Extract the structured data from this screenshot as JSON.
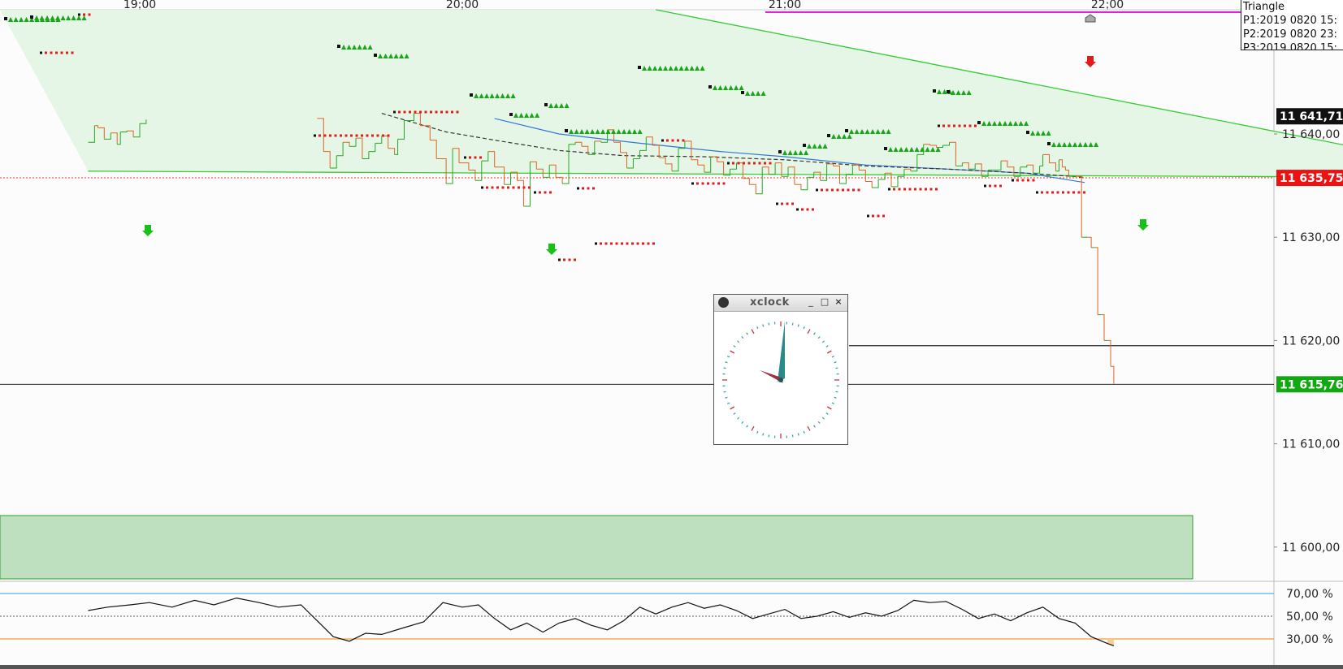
{
  "window": {
    "title": "xclock",
    "minimize_icon": "minimize-icon",
    "maximize_icon": "maximize-icon",
    "close_icon": "close-icon",
    "app_icon": "clock-icon"
  },
  "legend": {
    "title": "Triangle",
    "lines": [
      "P1:2019 0820 15:",
      "P2:2019 0820 23:",
      "P3:2019 0820 15:"
    ]
  },
  "time_axis": [
    {
      "label": "19:00",
      "t": 19.0
    },
    {
      "label": "20:00",
      "t": 20.0
    },
    {
      "label": "21:00",
      "t": 21.0
    },
    {
      "label": "22:00",
      "t": 22.0
    }
  ],
  "price_axis": [
    {
      "label": "11 640,00",
      "v": 11640
    },
    {
      "label": "11 630,00",
      "v": 11630
    },
    {
      "label": "11 620,00",
      "v": 11620
    },
    {
      "label": "11 610,00",
      "v": 11610
    },
    {
      "label": "11 600,00",
      "v": 11600
    }
  ],
  "price_tags": [
    {
      "label": "11 641,71",
      "v": 11641.71,
      "color": "#111111"
    },
    {
      "label": "11 635,75",
      "v": 11635.75,
      "color": "#ee1111"
    },
    {
      "label": "11 615,76",
      "v": 11615.76,
      "color": "#12a812"
    }
  ],
  "rsi_axis": [
    {
      "label": "70,00 %",
      "v": 70
    },
    {
      "label": "50,00 %",
      "v": 50
    },
    {
      "label": "30,00 %",
      "v": 30
    }
  ],
  "colors": {
    "up": "#22aa22",
    "down": "#dd6622",
    "ma_fast": "#3377dd",
    "triangle": "#33cc33",
    "triangle_fill": "#e6f6e6",
    "zone_fill": "#bfe0bf",
    "magenta": "#dd22dd",
    "rsi_top": "#4fb4e6",
    "rsi_bottom": "#f0a030",
    "rsi_fill": "#f6cd98"
  },
  "chart_data": {
    "type": "line",
    "x_unit": "hour",
    "series": [
      {
        "values": [
          [
            18.84,
            11639.2
          ],
          [
            18.86,
            11640.8
          ],
          [
            18.87,
            11640.6
          ],
          [
            18.89,
            11639.5
          ],
          [
            18.91,
            11640.1
          ],
          [
            18.93,
            11639.0
          ],
          [
            18.94,
            11640.2
          ],
          [
            18.96,
            11640.3
          ],
          [
            18.98,
            11639.7
          ],
          [
            19.0,
            11641.0
          ],
          [
            19.02,
            11641.4
          ],
          [
            19.55,
            11641.5
          ],
          [
            19.57,
            11638.3
          ],
          [
            19.59,
            11636.7
          ],
          [
            19.61,
            11637.9
          ],
          [
            19.63,
            11639.2
          ],
          [
            19.65,
            11638.8
          ],
          [
            19.67,
            11639.6
          ],
          [
            19.69,
            11637.6
          ],
          [
            19.71,
            11638.3
          ],
          [
            19.73,
            11639.1
          ],
          [
            19.75,
            11639.8
          ],
          [
            19.77,
            11638.6
          ],
          [
            19.79,
            11638.0
          ],
          [
            19.8,
            11639.5
          ],
          [
            19.82,
            11641.3
          ],
          [
            19.85,
            11642.0
          ],
          [
            19.87,
            11640.8
          ],
          [
            19.9,
            11639.4
          ],
          [
            19.92,
            11637.6
          ],
          [
            19.95,
            11635.2
          ],
          [
            19.97,
            11638.6
          ],
          [
            19.99,
            11637.2
          ],
          [
            20.02,
            11636.5
          ],
          [
            20.04,
            11635.5
          ],
          [
            20.06,
            11637.4
          ],
          [
            20.08,
            11638.3
          ],
          [
            20.1,
            11636.8
          ],
          [
            20.13,
            11635.1
          ],
          [
            20.15,
            11636.3
          ],
          [
            20.17,
            11635.5
          ],
          [
            20.19,
            11633.0
          ],
          [
            20.21,
            11637.3
          ],
          [
            20.23,
            11636.6
          ],
          [
            20.25,
            11635.8
          ],
          [
            20.27,
            11637.0
          ],
          [
            20.29,
            11635.8
          ],
          [
            20.31,
            11635.2
          ],
          [
            20.33,
            11639.0
          ],
          [
            20.35,
            11639.2
          ],
          [
            20.37,
            11638.8
          ],
          [
            20.39,
            11638.0
          ],
          [
            20.41,
            11639.3
          ],
          [
            20.43,
            11639.2
          ],
          [
            20.45,
            11640.4
          ],
          [
            20.47,
            11639.2
          ],
          [
            20.49,
            11638.2
          ],
          [
            20.51,
            11636.7
          ],
          [
            20.53,
            11637.6
          ],
          [
            20.55,
            11638.4
          ],
          [
            20.57,
            11639.7
          ],
          [
            20.59,
            11638.9
          ],
          [
            20.61,
            11637.7
          ],
          [
            20.63,
            11637.1
          ],
          [
            20.65,
            11636.4
          ],
          [
            20.67,
            11638.6
          ],
          [
            20.69,
            11639.3
          ],
          [
            20.71,
            11637.5
          ],
          [
            20.73,
            11637.0
          ],
          [
            20.75,
            11636.3
          ],
          [
            20.77,
            11637.8
          ],
          [
            20.79,
            11637.3
          ],
          [
            20.81,
            11636.0
          ],
          [
            20.83,
            11636.6
          ],
          [
            20.85,
            11637.2
          ],
          [
            20.87,
            11635.7
          ],
          [
            20.89,
            11635.1
          ],
          [
            20.91,
            11634.2
          ],
          [
            20.93,
            11636.8
          ],
          [
            20.95,
            11636.1
          ],
          [
            20.97,
            11637.2
          ],
          [
            20.99,
            11635.9
          ],
          [
            21.01,
            11636.8
          ],
          [
            21.03,
            11635.1
          ],
          [
            21.05,
            11634.6
          ],
          [
            21.07,
            11635.8
          ],
          [
            21.09,
            11636.3
          ],
          [
            21.11,
            11635.5
          ],
          [
            21.13,
            11637.1
          ],
          [
            21.15,
            11636.9
          ],
          [
            21.17,
            11635.2
          ],
          [
            21.19,
            11636.1
          ],
          [
            21.21,
            11637.0
          ],
          [
            21.23,
            11636.5
          ],
          [
            21.25,
            11635.4
          ],
          [
            21.27,
            11634.8
          ],
          [
            21.29,
            11635.6
          ],
          [
            21.31,
            11636.2
          ],
          [
            21.33,
            11634.9
          ],
          [
            21.35,
            11635.9
          ],
          [
            21.37,
            11636.6
          ],
          [
            21.39,
            11636.4
          ],
          [
            21.41,
            11638.0
          ],
          [
            21.43,
            11639.0
          ],
          [
            21.45,
            11638.9
          ],
          [
            21.47,
            11638.7
          ],
          [
            21.49,
            11638.9
          ],
          [
            21.51,
            11639.2
          ],
          [
            21.53,
            11636.9
          ],
          [
            21.55,
            11637.2
          ],
          [
            21.57,
            11636.6
          ],
          [
            21.59,
            11637.1
          ],
          [
            21.61,
            11635.9
          ],
          [
            21.63,
            11636.5
          ],
          [
            21.65,
            11636.5
          ],
          [
            21.67,
            11637.4
          ],
          [
            21.69,
            11636.8
          ],
          [
            21.71,
            11635.9
          ],
          [
            21.73,
            11636.8
          ],
          [
            21.75,
            11637.0
          ],
          [
            21.77,
            11636.2
          ],
          [
            21.79,
            11636.9
          ],
          [
            21.8,
            11638.0
          ],
          [
            21.82,
            11637.2
          ],
          [
            21.84,
            11636.4
          ],
          [
            21.85,
            11637.5
          ],
          [
            21.86,
            11636.8
          ],
          [
            21.87,
            11636.5
          ],
          [
            21.88,
            11635.9
          ],
          [
            21.9,
            11635.9
          ],
          [
            21.92,
            11630.0
          ],
          [
            21.94,
            11630.0
          ],
          [
            21.95,
            11629.0
          ],
          [
            21.96,
            11629.0
          ],
          [
            21.97,
            11622.5
          ],
          [
            21.98,
            11622.5
          ],
          [
            21.99,
            11620.0
          ],
          [
            22.0,
            11620.0
          ],
          [
            22.01,
            11617.5
          ],
          [
            22.02,
            11615.8
          ]
        ]
      },
      {
        "values": [
          [
            20.1,
            11641.5
          ],
          [
            20.3,
            11640.0
          ],
          [
            20.55,
            11639.1
          ],
          [
            20.8,
            11638.3
          ],
          [
            21.0,
            11637.8
          ],
          [
            21.25,
            11637.0
          ],
          [
            21.5,
            11636.6
          ],
          [
            21.75,
            11636.2
          ],
          [
            21.93,
            11635.3
          ]
        ]
      },
      {
        "values": [
          [
            19.75,
            11642.0
          ],
          [
            19.95,
            11640.2
          ],
          [
            20.1,
            11639.4
          ],
          [
            20.3,
            11638.4
          ],
          [
            20.5,
            11637.9
          ],
          [
            20.75,
            11637.8
          ],
          [
            21.0,
            11637.5
          ],
          [
            21.25,
            11636.9
          ],
          [
            21.5,
            11636.6
          ],
          [
            21.75,
            11636.2
          ],
          [
            21.93,
            11635.8
          ]
        ]
      }
    ],
    "triangle": {
      "upper": [
        [
          20.6,
          11641.7
        ],
        [
          23.0,
          11637.3
        ]
      ],
      "lower": [
        [
          18.84,
          11636.4
        ],
        [
          23.0,
          11635.8
        ]
      ]
    },
    "rsi": {
      "values": [
        [
          18.84,
          55
        ],
        [
          18.9,
          58
        ],
        [
          18.97,
          60
        ],
        [
          19.03,
          62
        ],
        [
          19.1,
          58
        ],
        [
          19.17,
          64
        ],
        [
          19.23,
          60
        ],
        [
          19.3,
          66
        ],
        [
          19.37,
          62
        ],
        [
          19.43,
          58
        ],
        [
          19.5,
          60
        ],
        [
          19.55,
          46
        ],
        [
          19.6,
          32
        ],
        [
          19.65,
          28
        ],
        [
          19.7,
          35
        ],
        [
          19.75,
          34
        ],
        [
          19.82,
          40
        ],
        [
          19.88,
          45
        ],
        [
          19.94,
          62
        ],
        [
          20.0,
          58
        ],
        [
          20.05,
          60
        ],
        [
          20.1,
          48
        ],
        [
          20.15,
          38
        ],
        [
          20.2,
          44
        ],
        [
          20.25,
          36
        ],
        [
          20.3,
          44
        ],
        [
          20.35,
          48
        ],
        [
          20.4,
          42
        ],
        [
          20.45,
          38
        ],
        [
          20.5,
          46
        ],
        [
          20.55,
          58
        ],
        [
          20.6,
          52
        ],
        [
          20.65,
          58
        ],
        [
          20.7,
          62
        ],
        [
          20.75,
          57
        ],
        [
          20.8,
          60
        ],
        [
          20.85,
          55
        ],
        [
          20.9,
          48
        ],
        [
          20.95,
          52
        ],
        [
          21.0,
          56
        ],
        [
          21.05,
          48
        ],
        [
          21.1,
          50
        ],
        [
          21.15,
          54
        ],
        [
          21.2,
          49
        ],
        [
          21.25,
          53
        ],
        [
          21.3,
          50
        ],
        [
          21.35,
          55
        ],
        [
          21.4,
          64
        ],
        [
          21.45,
          62
        ],
        [
          21.5,
          63
        ],
        [
          21.55,
          56
        ],
        [
          21.6,
          48
        ],
        [
          21.65,
          52
        ],
        [
          21.7,
          46
        ],
        [
          21.75,
          53
        ],
        [
          21.8,
          58
        ],
        [
          21.85,
          48
        ],
        [
          21.9,
          44
        ],
        [
          21.95,
          32
        ],
        [
          22.0,
          26
        ],
        [
          22.02,
          24
        ]
      ],
      "upper_band": 70,
      "lower_band": 30,
      "mid": 50
    }
  }
}
